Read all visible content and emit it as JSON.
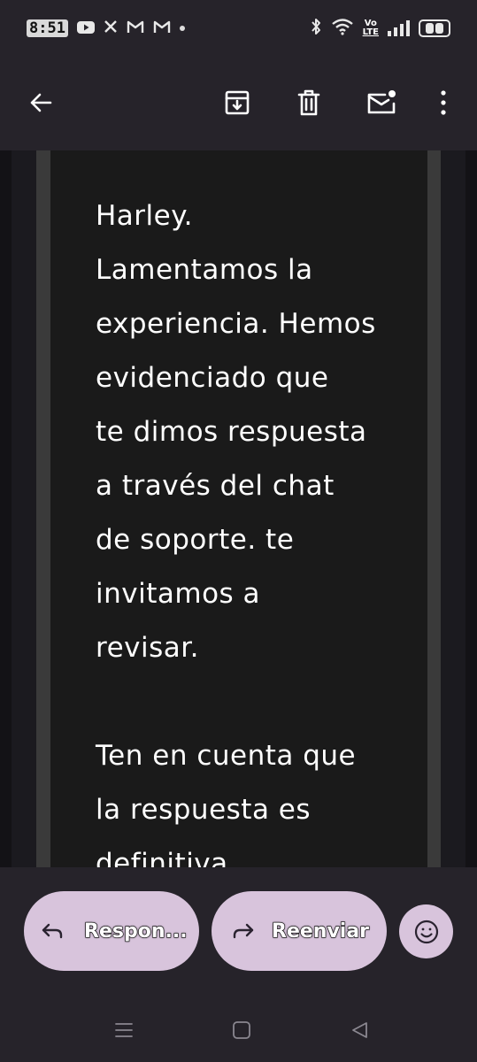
{
  "status_bar": {
    "time": "8:51",
    "network_label_top": "Vo",
    "network_label_bottom": "LTE",
    "notification_icons": [
      "youtube-icon",
      "x-icon",
      "gmail-icon",
      "gmail-icon",
      "dot-icon"
    ],
    "system_icons": [
      "bluetooth-icon",
      "wifi-icon",
      "volte-icon",
      "signal-icon",
      "battery-icon"
    ]
  },
  "toolbar": {
    "back_icon": "arrow-left-icon",
    "actions": [
      "archive-icon",
      "delete-icon",
      "mark-unread-icon",
      "more-vert-icon"
    ]
  },
  "email": {
    "lines": [
      "Harley.",
      "Lamentamos la",
      "experiencia. Hemos",
      "evidenciado que",
      "te dimos respuesta",
      "a través del chat",
      "de soporte. te",
      "invitamos a",
      "revisar.",
      "",
      "Ten en cuenta que",
      "la respuesta es",
      "definitiva."
    ]
  },
  "actions": {
    "reply_label": "Respon...",
    "forward_label": "Reenviar",
    "emoji_icon": "emoji-smile-icon"
  },
  "colors": {
    "background": "#26232a",
    "content_bg": "#131216",
    "panel_bg": "#1a1a1a",
    "pill_bg": "#d8c4dc"
  },
  "navbar": {
    "buttons": [
      "menu-icon",
      "home-square-icon",
      "back-triangle-icon"
    ]
  }
}
